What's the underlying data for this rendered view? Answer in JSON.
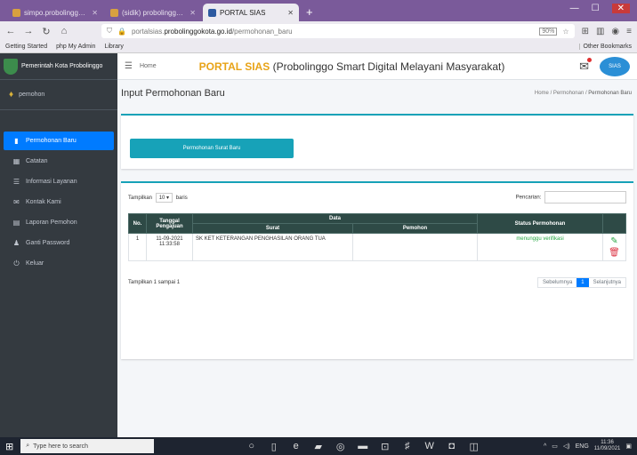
{
  "browser": {
    "tabs": [
      {
        "label": "simpo.probolinggokota.go.id",
        "active": false
      },
      {
        "label": "(sidik) probolinggokota.go.id",
        "active": false
      },
      {
        "label": "PORTAL SIAS",
        "active": true
      }
    ],
    "new_tab": "+",
    "url_prefix": "portalsias.",
    "url_host": "probolinggokota.go.id",
    "url_path": "/permohonan_baru",
    "zoom": "90%",
    "bookmarks": [
      "Getting Started",
      "php My Admin",
      "Library"
    ],
    "other_bookmarks": "Other Bookmarks"
  },
  "sidebar": {
    "brand": "Pemerintah Kota Probolinggo",
    "user": "pemohon",
    "items": [
      {
        "label": "Permohonan Baru",
        "icon": "file-icon",
        "active": true
      },
      {
        "label": "Catatan",
        "icon": "calendar-icon",
        "active": false
      },
      {
        "label": "Informasi Layanan",
        "icon": "list-icon",
        "active": false
      },
      {
        "label": "Kontak Kami",
        "icon": "mail-icon",
        "active": false
      },
      {
        "label": "Laporan Pemohon",
        "icon": "table-icon",
        "active": false
      },
      {
        "label": "Ganti Password",
        "icon": "user-icon",
        "active": false
      },
      {
        "label": "Keluar",
        "icon": "power-icon",
        "active": false
      }
    ]
  },
  "topnav": {
    "home_label": "Home",
    "portal_prefix": "PORTAL SIAS",
    "portal_rest": " (Probolinggo Smart Digital Melayani Masyarakat)",
    "logo_text": "SIAS"
  },
  "page": {
    "title": "Input Permohonan Baru",
    "breadcrumb_home": "Home",
    "breadcrumb_mid": "Permohonan",
    "breadcrumb_active": "Permohonan Baru",
    "new_button": "Permohonan Surat Baru"
  },
  "table": {
    "show_label": "Tampilkan",
    "show_value": "10",
    "entries_label": "baris",
    "search_label": "Pencarian:",
    "headers": {
      "no": "No.",
      "tanggal": "Tanggal Pengajuan",
      "data": "Data",
      "surat": "Surat",
      "pemohon": "Pemohon",
      "status": "Status Permohonan"
    },
    "rows": [
      {
        "no": "1",
        "date": "11-09-2021",
        "time": "11:33:58",
        "surat": "SK KET KETERANGAN PENGHASILAN ORANG TUA",
        "pemohon": "",
        "status": "menunggu verifikasi"
      }
    ],
    "info": "Tampilkan 1 sampai 1",
    "prev": "Sebelumnya",
    "page": "1",
    "next": "Selanjutnya"
  },
  "taskbar": {
    "search_placeholder": "Type here to search",
    "lang": "ENG",
    "time": "11:36",
    "date": "11/09/2021"
  }
}
